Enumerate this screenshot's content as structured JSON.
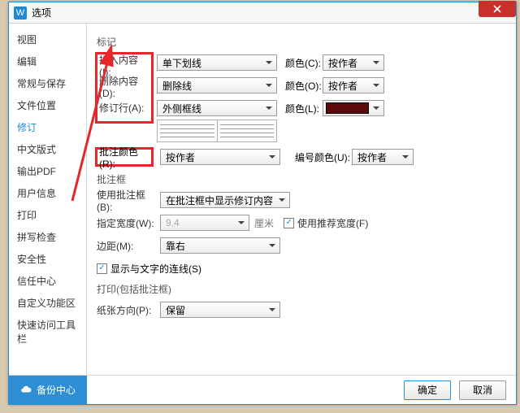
{
  "window": {
    "title": "选项"
  },
  "sidebar": {
    "items": [
      {
        "label": "视图"
      },
      {
        "label": "编辑"
      },
      {
        "label": "常规与保存"
      },
      {
        "label": "文件位置"
      },
      {
        "label": "修订",
        "active": true
      },
      {
        "label": "中文版式"
      },
      {
        "label": "输出PDF"
      },
      {
        "label": "用户信息"
      },
      {
        "label": "打印"
      },
      {
        "label": "拼写检查"
      },
      {
        "label": "安全性"
      },
      {
        "label": "信任中心"
      },
      {
        "label": "自定义功能区"
      },
      {
        "label": "快速访问工具栏"
      }
    ],
    "backup": "备份中心"
  },
  "main": {
    "marks_section": "标记",
    "insert_lbl": "插入内容(I):",
    "insert_val": "单下划线",
    "delete_lbl": "删除内容(D):",
    "delete_val": "删除线",
    "revrow_lbl": "修订行(A):",
    "revrow_val": "外侧框线",
    "color_c_lbl": "颜色(C):",
    "color_c_val": "按作者",
    "color_o_lbl": "颜色(O):",
    "color_o_val": "按作者",
    "color_l_lbl": "颜色(L):",
    "color_l_hex": "#5a0a0a",
    "comment_color_lbl": "批注颜色(R):",
    "comment_color_val": "按作者",
    "number_color_lbl": "编号颜色(U):",
    "number_color_val": "按作者",
    "balloon_section": "批注框",
    "use_balloon_lbl": "使用批注框(B):",
    "use_balloon_val": "在批注框中显示修订内容",
    "width_lbl": "指定宽度(W):",
    "width_val": "9.4",
    "width_unit": "厘米",
    "recommend_lbl": "使用推荐宽度(F)",
    "recommend_checked": true,
    "margin_lbl": "边距(M):",
    "margin_val": "靠右",
    "connector_lbl": "显示与文字的连线(S)",
    "connector_checked": true,
    "print_section": "打印(包括批注框)",
    "paper_lbl": "纸张方向(P):",
    "paper_val": "保留"
  },
  "buttons": {
    "ok": "确定",
    "cancel": "取消"
  }
}
